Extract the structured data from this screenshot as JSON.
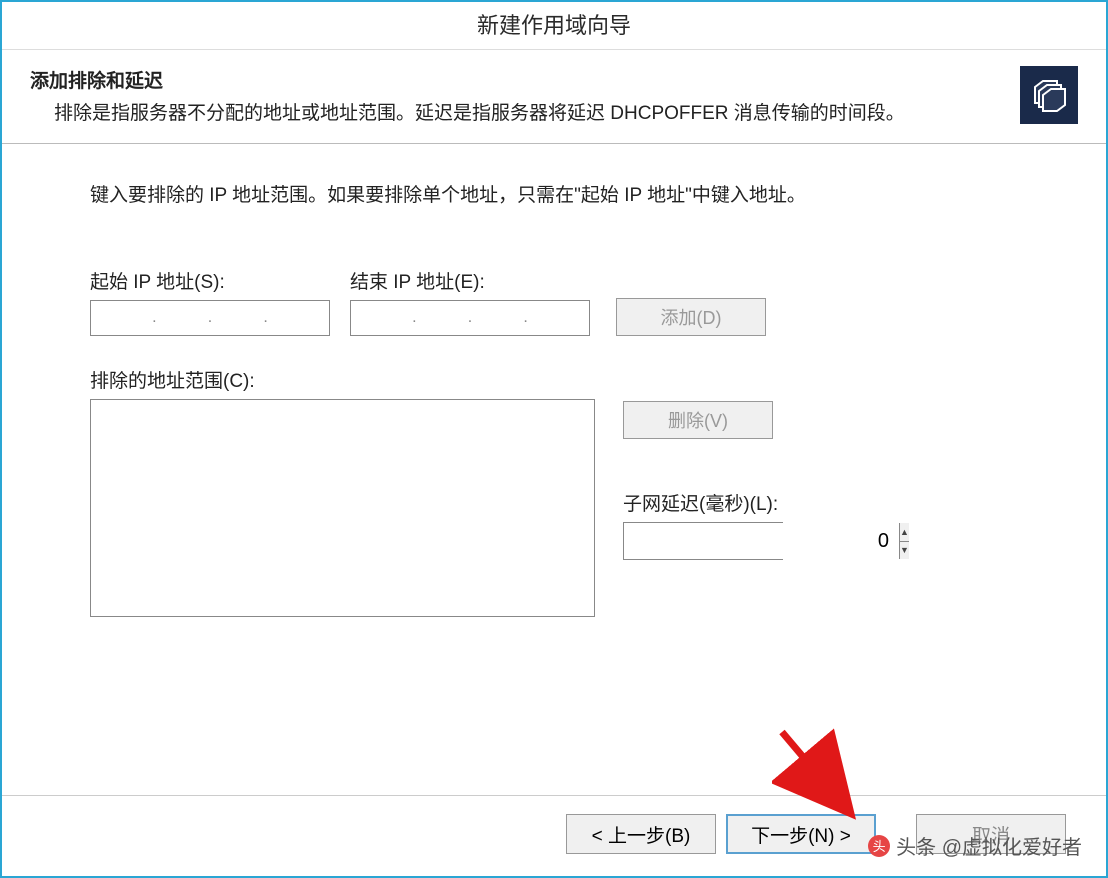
{
  "window": {
    "title": "新建作用域向导"
  },
  "header": {
    "title": "添加排除和延迟",
    "description": "排除是指服务器不分配的地址或地址范围。延迟是指服务器将延迟 DHCPOFFER 消息传输的时间段。"
  },
  "body": {
    "instruction": "键入要排除的 IP 地址范围。如果要排除单个地址，只需在\"起始 IP 地址\"中键入地址。",
    "start_ip_label": "起始 IP 地址(S):",
    "end_ip_label": "结束 IP 地址(E):",
    "add_button": "添加(D)",
    "exclude_list_label": "排除的地址范围(C):",
    "delete_button": "删除(V)",
    "delay_label": "子网延迟(毫秒)(L):",
    "delay_value": "0"
  },
  "footer": {
    "back": "< 上一步(B)",
    "next": "下一步(N) >",
    "cancel": "取消"
  },
  "watermark": {
    "text": "头条 @虚拟化爱好者"
  }
}
